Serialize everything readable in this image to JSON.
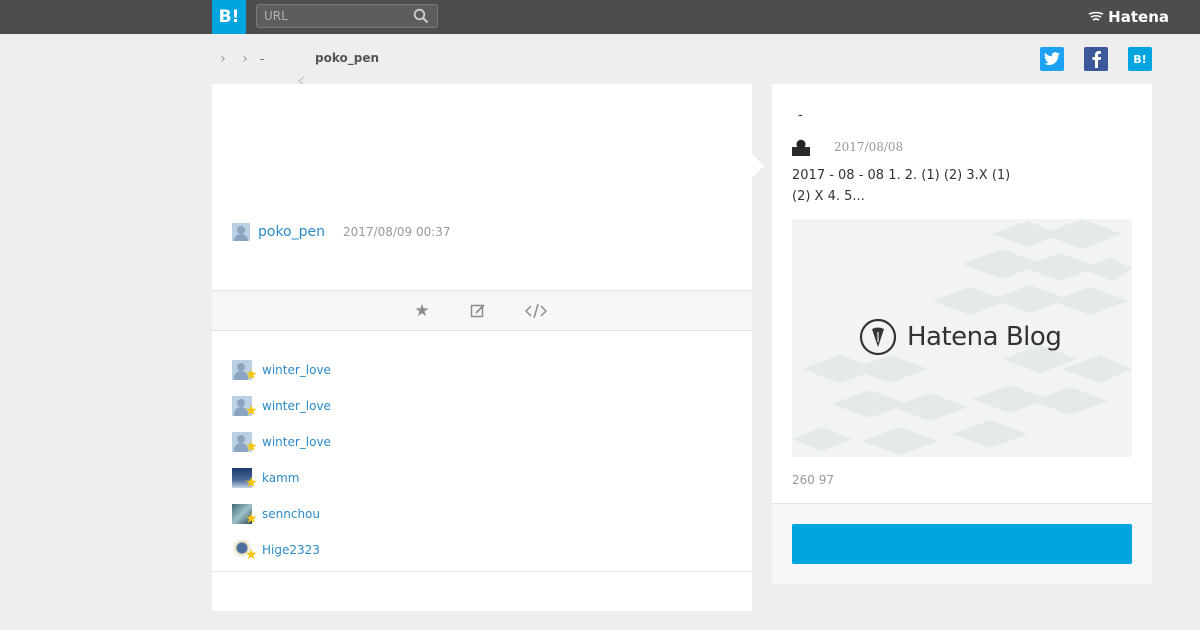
{
  "topbar": {
    "logo": "B!",
    "search_placeholder": "URL",
    "brand": "Hatena"
  },
  "breadcrumb": {
    "dash": "-",
    "user": "poko_pen"
  },
  "share": {
    "hatena": "B!"
  },
  "entry": {
    "user": "poko_pen",
    "timestamp": "2017/08/09 00:37"
  },
  "stars": [
    {
      "name": "winter_love"
    },
    {
      "name": "winter_love"
    },
    {
      "name": "winter_love"
    },
    {
      "name": "kamm"
    },
    {
      "name": "sennchou"
    },
    {
      "name": "Hige2323"
    }
  ],
  "article": {
    "title": "-",
    "date": "2017/08/08",
    "desc_line1": "2017 - 08 - 08  1.  2.  (1)  (2) 3.X (1)",
    "desc_line2": "(2) X 4.  5...",
    "thumb_text": "Hatena Blog",
    "counts": "260 97",
    "button_label": ""
  },
  "colors": {
    "topbar": "#4d4d4d",
    "accent": "#00a4de",
    "link": "#2a8bc7",
    "star": "#f5c400"
  }
}
